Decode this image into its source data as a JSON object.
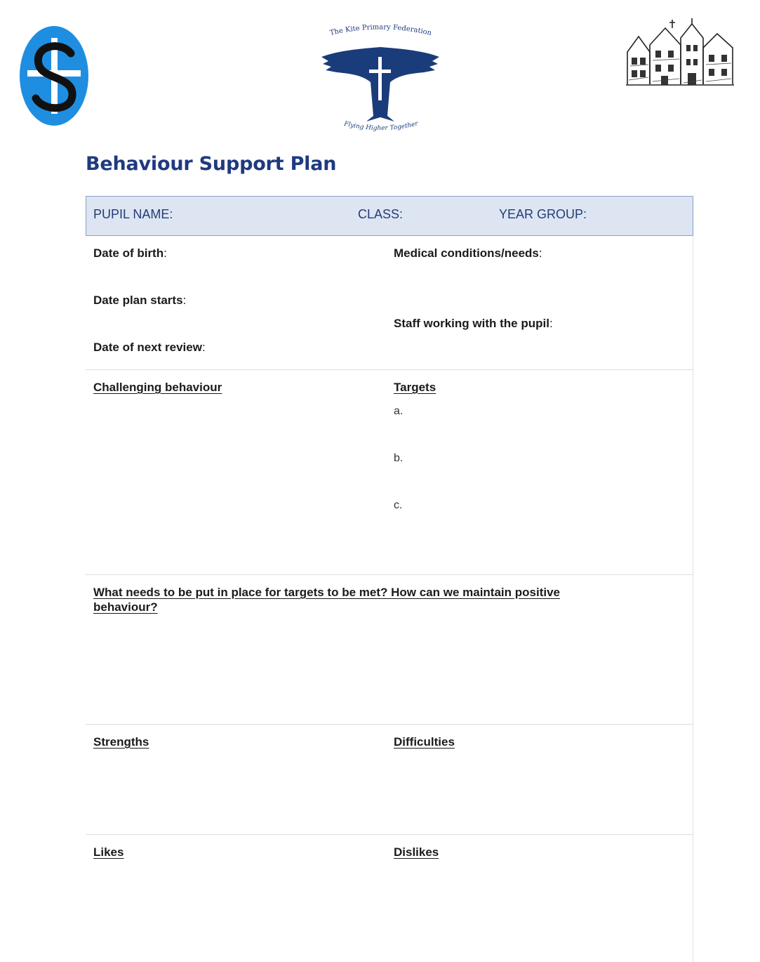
{
  "logos": {
    "left_icon": "school-cross-s-logo",
    "center_top_text": "The Kite Primary Federation",
    "center_bottom_text": "Flying Higher Together",
    "right_icon": "school-building-sketch"
  },
  "colors": {
    "title": "#1f3a80",
    "header_bg": "#dde5f3",
    "logo_blue": "#1f8ee0",
    "kite_navy": "#1b3c7a"
  },
  "title": "Behaviour Support Plan",
  "header": {
    "pupil_name": "PUPIL NAME:",
    "class": "CLASS:",
    "year_group": "YEAR GROUP:"
  },
  "details": {
    "dob": "Date of birth",
    "plan_start": "Date plan starts",
    "next_review": "Date of next review",
    "medical": "Medical conditions/needs",
    "staff": "Staff working with the pupil",
    "colon": ":"
  },
  "sections": {
    "challenging": "Challenging behaviour",
    "targets": "Targets",
    "target_items": [
      "a.",
      "b.",
      "c."
    ],
    "needs": "What needs to be put in place for targets to be met? How can we maintain positive behaviour?",
    "strengths": "Strengths",
    "difficulties": "Difficulties",
    "likes": "Likes",
    "dislikes": "Dislikes"
  }
}
